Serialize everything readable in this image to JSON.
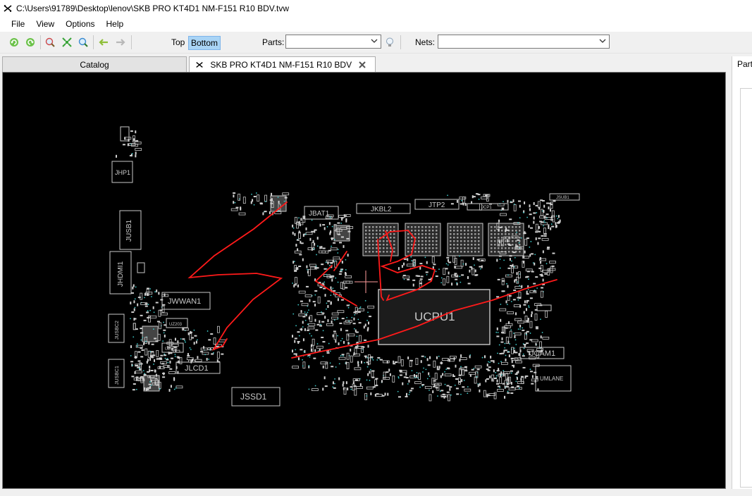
{
  "window": {
    "title": "C:\\Users\\91789\\Desktop\\lenov\\SKB PRO KT4D1 NM-F151 R10 BDV.tvw"
  },
  "menu": [
    {
      "label": "File"
    },
    {
      "label": "View"
    },
    {
      "label": "Options"
    },
    {
      "label": "Help"
    }
  ],
  "toolbar": {
    "top_label": "Top",
    "bottom_label": "Bottom",
    "parts_label": "Parts:",
    "parts_value": "",
    "nets_label": "Nets:",
    "nets_value": "",
    "active_layer": "Bottom"
  },
  "tabs": [
    {
      "label": "Catalog"
    },
    {
      "label": "SKB PRO KT4D1 NM-F151 R10 BDV"
    }
  ],
  "right_panel": {
    "header": "Parts"
  },
  "board": {
    "labels": {
      "jhp1": "JHP1",
      "jusb1": "JUSB1",
      "jhdmi1": "JHDMI1",
      "jwwan1": "JWWAN1",
      "jusbc2": "JUSBC2",
      "jusbc1": "JUSBC1",
      "uz203": "UZ203",
      "uz202": "UZ202",
      "jlcd1": "JLCD1",
      "jssd1": "JSSD1",
      "jbat1": "JBAT1",
      "jkbl2": "JKBL2",
      "jtp2": "JTP2",
      "jcp1": "JCP1",
      "jsub1": "JSUB1",
      "ucpu1": "UCPU1",
      "jcam1": "JCAM1",
      "umlane": "UMLANE"
    },
    "colors": {
      "outline": "#c8c8c8",
      "annotation": "#ff1a1a",
      "via": "#3cc8c8",
      "background": "#000000"
    }
  }
}
